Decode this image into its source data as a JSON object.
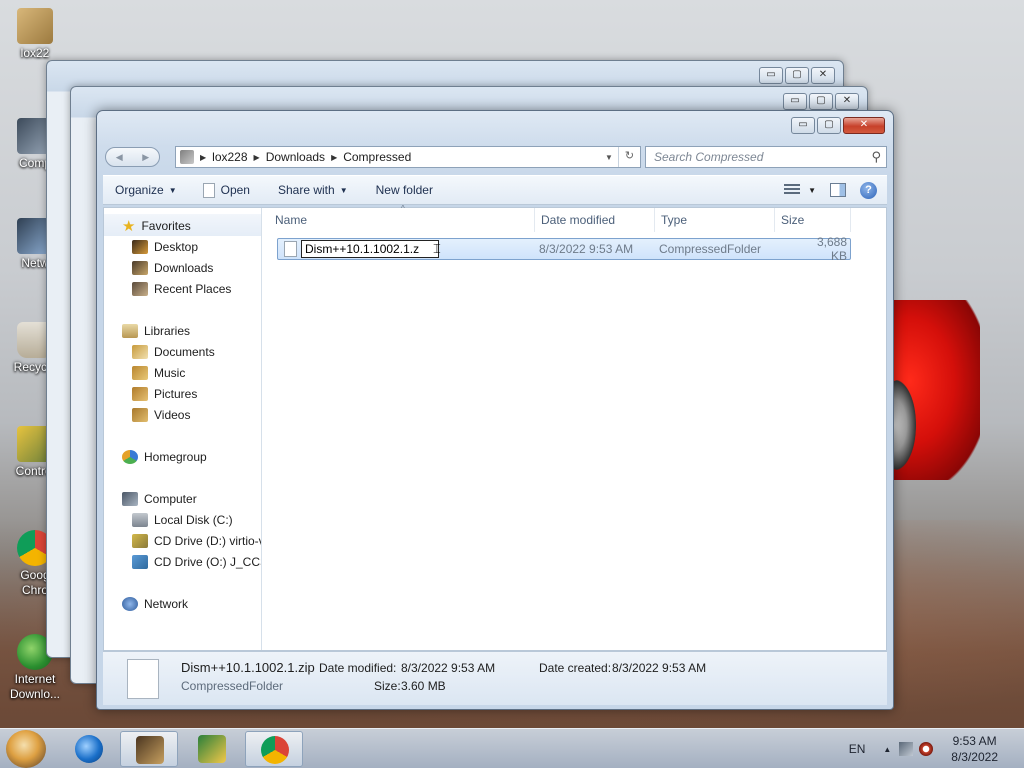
{
  "desktop": {
    "icons": [
      {
        "label": "lox22",
        "icon": "folder-user-icon"
      },
      {
        "label": "Comp",
        "icon": "computer-icon"
      },
      {
        "label": "Netw",
        "icon": "network-icon"
      },
      {
        "label": "Recycle",
        "icon": "recycle-bin-icon"
      },
      {
        "label": "Control",
        "icon": "control-panel-icon"
      },
      {
        "label": "Goog",
        "label2": "Chro",
        "icon": "chrome-icon"
      },
      {
        "label": "Internet",
        "label2": "Downlo...",
        "icon": "internet-download-manager-icon"
      }
    ]
  },
  "window": {
    "caption_buttons": {
      "minimize": "▭",
      "maximize": "▢",
      "close": "✕"
    },
    "nav": {
      "back": "◀",
      "forward": "▶"
    },
    "address": {
      "segments": [
        "lox228",
        "Downloads",
        "Compressed"
      ],
      "separator": "▶",
      "dropdown": "▼",
      "refresh": "↻"
    },
    "search": {
      "placeholder": "Search Compressed",
      "icon": "search-icon"
    },
    "toolbar": {
      "organize": "Organize",
      "open": "Open",
      "share_with": "Share with",
      "new_folder": "New folder",
      "dropdown_arrow": "▼",
      "help": "?"
    },
    "navpane": {
      "favorites": {
        "title": "Favorites",
        "items": [
          "Desktop",
          "Downloads",
          "Recent Places"
        ]
      },
      "libraries": {
        "title": "Libraries",
        "items": [
          "Documents",
          "Music",
          "Pictures",
          "Videos"
        ]
      },
      "homegroup": "Homegroup",
      "computer": {
        "title": "Computer",
        "items": [
          "Local Disk (C:)",
          "CD Drive (D:) virtio-v",
          "CD Drive (O:) J_CCSA"
        ]
      },
      "network": "Network"
    },
    "columns": {
      "name": "Name",
      "date": "Date modified",
      "type": "Type",
      "size": "Size",
      "sort_caret": "^"
    },
    "files": [
      {
        "name_editing": "Dism++10.1.1002.1.z",
        "date": "8/3/2022 9:53 AM",
        "type": "CompressedFolder",
        "size": "3,688 KB"
      }
    ],
    "details": {
      "filename": "Dism++10.1.1002.1.zip",
      "filetype": "CompressedFolder",
      "modified_label": "Date modified:",
      "modified_value": "8/3/2022 9:53 AM",
      "created_label": "Date created:",
      "created_value": "8/3/2022 9:53 AM",
      "size_label": "Size:",
      "size_value": "3.60 MB"
    }
  },
  "taskbar": {
    "language": "EN",
    "tray_up_arrow": "▲",
    "time": "9:53 AM",
    "date": "8/3/2022"
  },
  "colors": {
    "accent": "#cfe3fb",
    "selection_border": "#7da2ce",
    "close_red": "#c7412b"
  }
}
